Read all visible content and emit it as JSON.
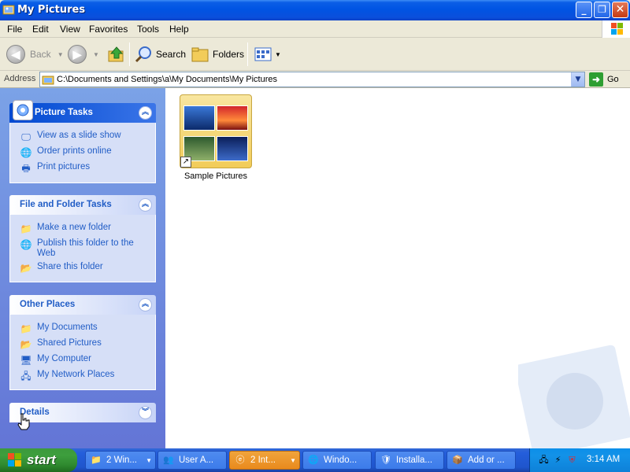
{
  "window": {
    "title": "My Pictures",
    "controls": {
      "minimize": "_",
      "maximize": "❐",
      "close": "✕"
    }
  },
  "menubar": {
    "items": [
      "File",
      "Edit",
      "View",
      "Favorites",
      "Tools",
      "Help"
    ]
  },
  "toolbar": {
    "back_label": "Back",
    "forward_label": "",
    "search_label": "Search",
    "folders_label": "Folders"
  },
  "address": {
    "label": "Address",
    "value": "C:\\Documents and Settings\\a\\My Documents\\My Pictures",
    "go_label": "Go"
  },
  "taskpane": {
    "picture_tasks": {
      "title": "Picture Tasks",
      "items": [
        {
          "label": "View as a slide show",
          "icon": "slideshow-icon"
        },
        {
          "label": "Order prints online",
          "icon": "globe-icon"
        },
        {
          "label": "Print pictures",
          "icon": "printer-icon"
        }
      ]
    },
    "file_folder_tasks": {
      "title": "File and Folder Tasks",
      "items": [
        {
          "label": "Make a new folder",
          "icon": "new-folder-icon"
        },
        {
          "label": "Publish this folder to the Web",
          "icon": "publish-web-icon"
        },
        {
          "label": "Share this folder",
          "icon": "share-folder-icon"
        }
      ]
    },
    "other_places": {
      "title": "Other Places",
      "items": [
        {
          "label": "My Documents",
          "icon": "my-documents-icon"
        },
        {
          "label": "Shared Pictures",
          "icon": "shared-pictures-icon"
        },
        {
          "label": "My Computer",
          "icon": "my-computer-icon"
        },
        {
          "label": "My Network Places",
          "icon": "network-places-icon"
        }
      ]
    },
    "details": {
      "title": "Details"
    }
  },
  "content": {
    "items": [
      {
        "label": "Sample Pictures",
        "type": "folder-shortcut"
      }
    ]
  },
  "taskbar": {
    "start_label": "start",
    "buttons": [
      {
        "label": "2 Win...",
        "active": false
      },
      {
        "label": "User A...",
        "active": false
      },
      {
        "label": "2 Int...",
        "active": true
      },
      {
        "label": "Windo...",
        "active": false
      },
      {
        "label": "Installa...",
        "active": false
      },
      {
        "label": "Add or ...",
        "active": false
      }
    ],
    "clock": "3:14 AM"
  },
  "colors": {
    "titlebar": "#0054e3",
    "taskpane": "#6375d6",
    "link": "#215dc6",
    "start": "#3d9e3d",
    "active_task": "#e98a1d"
  }
}
